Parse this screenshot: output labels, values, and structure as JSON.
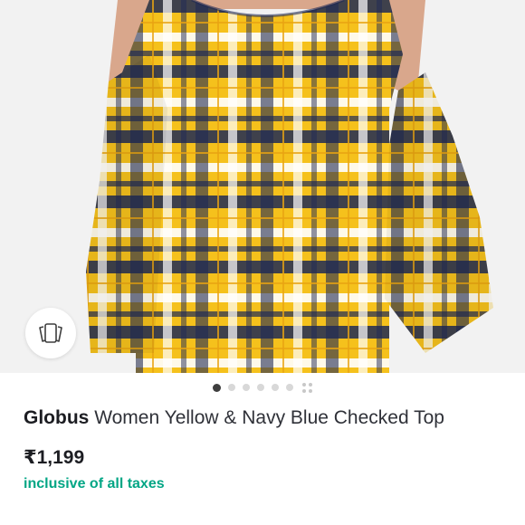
{
  "product": {
    "brand": "Globus",
    "name": "Women Yellow & Navy Blue Checked Top",
    "price": "₹1,199",
    "tax_note": "inclusive of all taxes"
  },
  "gallery": {
    "image_icon": "plaid-cold-shoulder-top-photo",
    "similar_icon": "view-similar-icon",
    "dot_count": 6,
    "active_dot": 0,
    "more_icon": "grid-dots-icon"
  },
  "colors": {
    "tax_green": "#03a685",
    "plaid_yellow": "#f5c11c",
    "plaid_navy": "#1f2a55",
    "background": "#f2f2f2"
  }
}
